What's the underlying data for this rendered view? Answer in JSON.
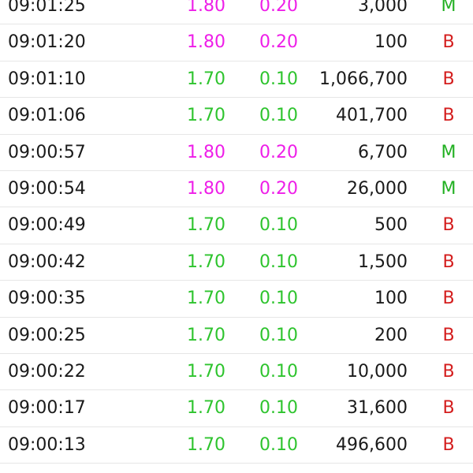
{
  "colors": {
    "up_price": "#2ec42e",
    "hi_price": "#ee1ee8",
    "side_buy": "#d41e1e",
    "side_market": "#22b022",
    "text": "#1a1a1a"
  },
  "trades": [
    {
      "time": "09:01:25",
      "price": "1.80",
      "change": "0.20",
      "volume": "3,000",
      "side": "M",
      "tone": "hi",
      "side_tone": "market"
    },
    {
      "time": "09:01:20",
      "price": "1.80",
      "change": "0.20",
      "volume": "100",
      "side": "B",
      "tone": "hi",
      "side_tone": "buy"
    },
    {
      "time": "09:01:10",
      "price": "1.70",
      "change": "0.10",
      "volume": "1,066,700",
      "side": "B",
      "tone": "up",
      "side_tone": "buy"
    },
    {
      "time": "09:01:06",
      "price": "1.70",
      "change": "0.10",
      "volume": "401,700",
      "side": "B",
      "tone": "up",
      "side_tone": "buy"
    },
    {
      "time": "09:00:57",
      "price": "1.80",
      "change": "0.20",
      "volume": "6,700",
      "side": "M",
      "tone": "hi",
      "side_tone": "market"
    },
    {
      "time": "09:00:54",
      "price": "1.80",
      "change": "0.20",
      "volume": "26,000",
      "side": "M",
      "tone": "hi",
      "side_tone": "market"
    },
    {
      "time": "09:00:49",
      "price": "1.70",
      "change": "0.10",
      "volume": "500",
      "side": "B",
      "tone": "up",
      "side_tone": "buy"
    },
    {
      "time": "09:00:42",
      "price": "1.70",
      "change": "0.10",
      "volume": "1,500",
      "side": "B",
      "tone": "up",
      "side_tone": "buy"
    },
    {
      "time": "09:00:35",
      "price": "1.70",
      "change": "0.10",
      "volume": "100",
      "side": "B",
      "tone": "up",
      "side_tone": "buy"
    },
    {
      "time": "09:00:25",
      "price": "1.70",
      "change": "0.10",
      "volume": "200",
      "side": "B",
      "tone": "up",
      "side_tone": "buy"
    },
    {
      "time": "09:00:22",
      "price": "1.70",
      "change": "0.10",
      "volume": "10,000",
      "side": "B",
      "tone": "up",
      "side_tone": "buy"
    },
    {
      "time": "09:00:17",
      "price": "1.70",
      "change": "0.10",
      "volume": "31,600",
      "side": "B",
      "tone": "up",
      "side_tone": "buy"
    },
    {
      "time": "09:00:13",
      "price": "1.70",
      "change": "0.10",
      "volume": "496,600",
      "side": "B",
      "tone": "up",
      "side_tone": "buy"
    }
  ]
}
